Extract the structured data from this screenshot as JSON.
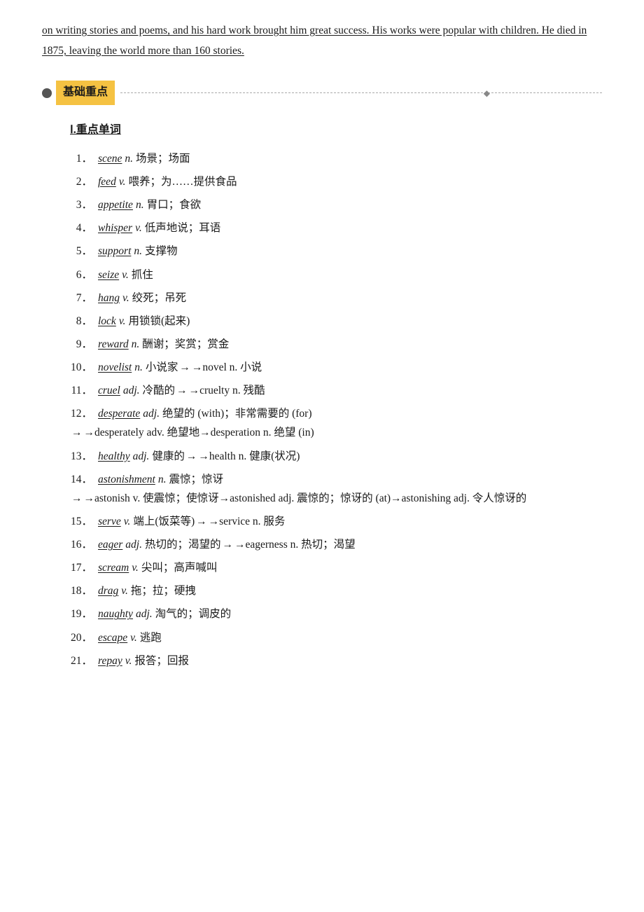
{
  "intro": {
    "text": " on writing stories and poems, and his hard work brought him great success. His works were popular with children. He died in 1875, leaving the world more than 160 stories."
  },
  "section": {
    "dot": "●",
    "title": "基础重点"
  },
  "vocab_heading": "Ⅰ.重点单词",
  "vocab_items": [
    {
      "num": "1．",
      "word": "scene",
      "pos": "n.",
      "def": " 场景；场面"
    },
    {
      "num": "2．",
      "word": "feed",
      "pos": "v.",
      "def": " 喂养；为……提供食品"
    },
    {
      "num": "3．",
      "word": "appetite",
      "pos": "n.",
      "def": " 胃口；食欲"
    },
    {
      "num": "4．",
      "word": "whisper",
      "pos": "v.",
      "def": " 低声地说；耳语"
    },
    {
      "num": "5．",
      "word": "support",
      "pos": "n.",
      "def": " 支撑物"
    },
    {
      "num": "6．",
      "word": "seize",
      "pos": "v.",
      "def": " 抓住"
    },
    {
      "num": "7．",
      "word": "hang",
      "pos": "v.",
      "def": " 绞死；吊死"
    },
    {
      "num": "8．",
      "word": "lock",
      "pos": "v.",
      "def": " 用锁锁(起来)"
    },
    {
      "num": "9．",
      "word": "reward",
      "pos": "n.",
      "def": " 酬谢；奖赏；赏金"
    },
    {
      "num": "10．",
      "word": "novelist",
      "pos": "n.",
      "def": " 小说家",
      "extra": "→novel n. 小说"
    },
    {
      "num": "11．",
      "word": "cruel",
      "pos": "adj.",
      "def": " 冷酷的",
      "extra": "→cruelty n. 残酷"
    },
    {
      "num": "12．",
      "word": "desperate",
      "pos": "adj.",
      "def": " 绝望的 (with)；非常需要的 (for)",
      "extra": "→desperately adv. 绝望地→desperation n. 绝望 (in)",
      "multiline": true
    },
    {
      "num": "13．",
      "word": "healthy",
      "pos": "adj.",
      "def": " 健康的",
      "extra": "→health n.  健康(状况)"
    },
    {
      "num": "14．",
      "word": "astonishment",
      "pos": "n.",
      "def": " 震惊；惊讶",
      "extra": "→astonish v. 使震惊；使惊讶→astonished adj. 震惊的；惊讶的 (at)→astonishing adj. 令人惊讶的",
      "multiline": true
    },
    {
      "num": "15．",
      "word": "serve",
      "pos": "v.",
      "def": " 端上(饭菜等)",
      "extra": "→service n. 服务"
    },
    {
      "num": "16．",
      "word": "eager",
      "pos": "adj.",
      "def": " 热切的；渴望的",
      "extra": "→eagerness n. 热切；渴望"
    },
    {
      "num": "17．",
      "word": "scream",
      "pos": "v.",
      "def": " 尖叫；高声喊叫"
    },
    {
      "num": "18．",
      "word": "drag",
      "pos": "v.",
      "def": " 拖；拉；硬拽"
    },
    {
      "num": "19．",
      "word": "naughty",
      "pos": "adj.",
      "def": " 淘气的；调皮的"
    },
    {
      "num": "20．",
      "word": "escape",
      "pos": "v.",
      "def": " 逃跑"
    },
    {
      "num": "21．",
      "word": "repay",
      "pos": "v.",
      "def": " 报答；回报"
    }
  ]
}
